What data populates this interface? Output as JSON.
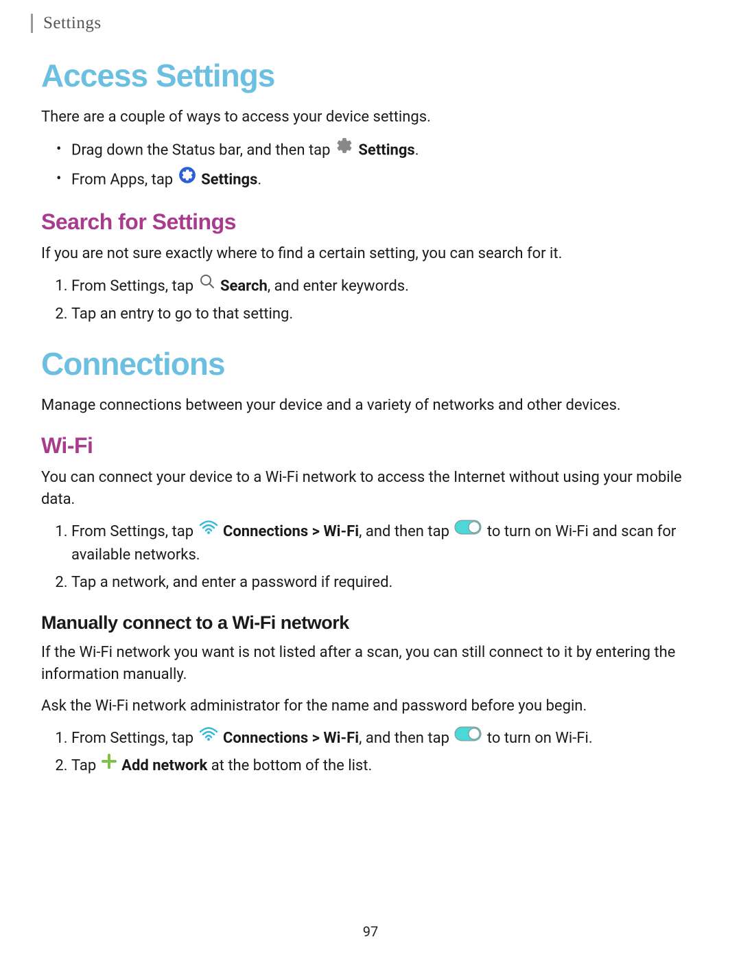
{
  "breadcrumb": "Settings",
  "h1_access": "Access Settings",
  "p_intro": "There are a couple of ways to access your device settings.",
  "bullet1_pre": "Drag down the Status bar, and then tap ",
  "bullet1_label": "Settings",
  "bullet1_post": ".",
  "bullet2_pre": "From Apps, tap ",
  "bullet2_label": "Settings",
  "bullet2_post": ".",
  "h2_search": "Search for Settings",
  "p_search_intro": "If you are not sure exactly where to find a certain setting, you can search for it.",
  "search_step1_pre": "From Settings, tap ",
  "search_step1_label": "Search",
  "search_step1_post": ", and enter keywords.",
  "search_step2": "Tap an entry to go to that setting.",
  "h1_connections": "Connections",
  "p_connections_intro": "Manage connections between your device and a variety of networks and other devices.",
  "h2_wifi": "Wi-Fi",
  "p_wifi_intro": "You can connect your device to a Wi-Fi network to access the Internet without using your mobile data.",
  "wifi_step1_pre": "From Settings, tap ",
  "wifi_step1_label": "Connections > Wi-Fi",
  "wifi_step1_mid": ", and then tap ",
  "wifi_step1_post": " to turn on Wi-Fi and scan for available networks.",
  "wifi_step2": "Tap a network, and enter a password if required.",
  "h3_manual": "Manually connect to a Wi-Fi network",
  "p_manual_intro": "If the Wi-Fi network you want is not listed after a scan, you can still connect to it by entering the information manually.",
  "p_manual_ask": "Ask the Wi-Fi network administrator for the name and password before you begin.",
  "manual_step1_pre": "From Settings, tap ",
  "manual_step1_label": "Connections > Wi-Fi",
  "manual_step1_mid": ", and then tap ",
  "manual_step1_post": " to turn on Wi-Fi.",
  "manual_step2_pre": "Tap ",
  "manual_step2_label": "Add network",
  "manual_step2_post": " at the bottom of the list.",
  "page_number": "97"
}
